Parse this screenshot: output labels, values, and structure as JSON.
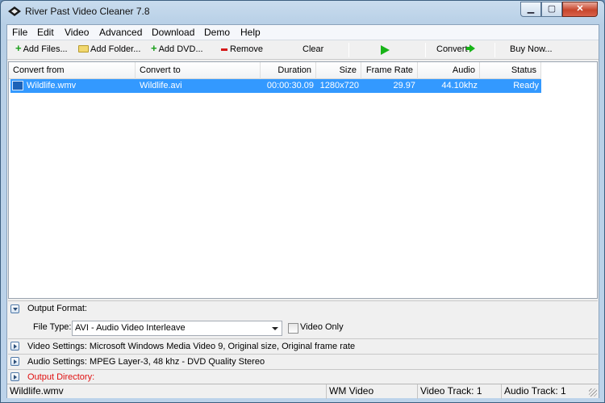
{
  "window": {
    "title": "River Past Video Cleaner 7.8"
  },
  "menu": [
    "File",
    "Edit",
    "Video",
    "Advanced",
    "Download",
    "Demo",
    "Help"
  ],
  "toolbar": {
    "add_files": "Add Files...",
    "add_folder": "Add Folder...",
    "add_dvd": "Add DVD...",
    "remove": "Remove",
    "clear": "Clear",
    "convert": "Convert",
    "buy_now": "Buy Now..."
  },
  "list": {
    "columns": [
      "Convert from",
      "Convert to",
      "Duration",
      "Size",
      "Frame Rate",
      "Audio",
      "Status"
    ],
    "rows": [
      {
        "from": "Wildlife.wmv",
        "to": "Wildlife.avi",
        "duration": "00:00:30.09",
        "size": "1280x720",
        "frame_rate": "29.97",
        "audio": "44.10khz",
        "status": "Ready"
      }
    ]
  },
  "output_format": {
    "label": "Output Format:",
    "file_type_label": "File Type:",
    "file_type_value": "AVI - Audio Video Interleave",
    "video_only_label": "Video Only"
  },
  "video_settings": "Video Settings: Microsoft Windows Media Video 9, Original size, Original frame rate",
  "audio_settings": "Audio Settings: MPEG Layer-3, 48 khz - DVD Quality Stereo",
  "output_directory": "Output Directory:",
  "statusbar": {
    "file": "Wildlife.wmv",
    "codec": "WM Video",
    "video_track": "Video Track: 1",
    "audio_track": "Audio Track: 1"
  },
  "colors": {
    "selection": "#3399ff",
    "accent_green": "#18b418",
    "warning_red": "#e01010"
  }
}
